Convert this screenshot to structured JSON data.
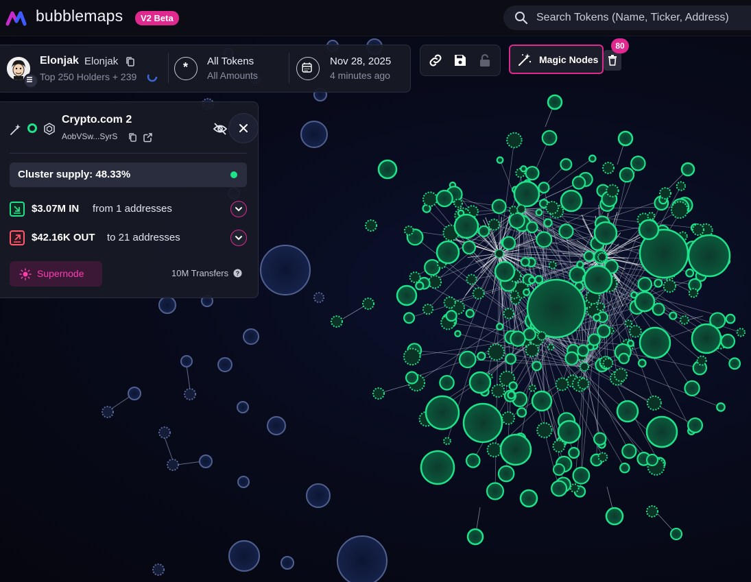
{
  "brand": {
    "name": "bubblemaps",
    "badge": "V2 Beta"
  },
  "search": {
    "placeholder": "Search Tokens (Name, Ticker, Address)"
  },
  "info_bar": {
    "token_name": "Elonjak",
    "token_ticker": "Elonjak",
    "holders_text": "Top 250 Holders + 239",
    "filter_title": "All Tokens",
    "filter_sub": "All Amounts",
    "date": "Nov 28, 2025",
    "date_sub": "4 minutes ago"
  },
  "toolbar": {
    "magic_nodes_label": "Magic Nodes",
    "magic_nodes_count": "80"
  },
  "cluster_card": {
    "title": "Crypto.com 2",
    "address": "AobVSw...SyrS",
    "supply_label": "Cluster supply: 48.33%",
    "inflow_amount": "$3.07M IN",
    "inflow_text": "from 1 addresses",
    "outflow_amount": "$42.16K OUT",
    "outflow_text": "to 21 addresses",
    "supernode_label": "Supernode",
    "transfers_label": "10M Transfers"
  },
  "colors": {
    "accent": "#e0298e",
    "cluster_green": "#1ee38a",
    "bubble_blue": "#2a3d6e",
    "inflow_icon": "#1ee38a",
    "outflow_icon": "#ff5a6e"
  },
  "icons": [
    "search-icon",
    "copy-icon",
    "loading-spinner-icon",
    "asterisk-icon",
    "calendar-icon",
    "link-icon",
    "save-icon",
    "lock-icon",
    "magic-wand-icon",
    "trash-icon",
    "eye-off-icon",
    "close-icon",
    "external-link-icon",
    "chevron-down-icon",
    "sun-icon",
    "help-icon"
  ]
}
